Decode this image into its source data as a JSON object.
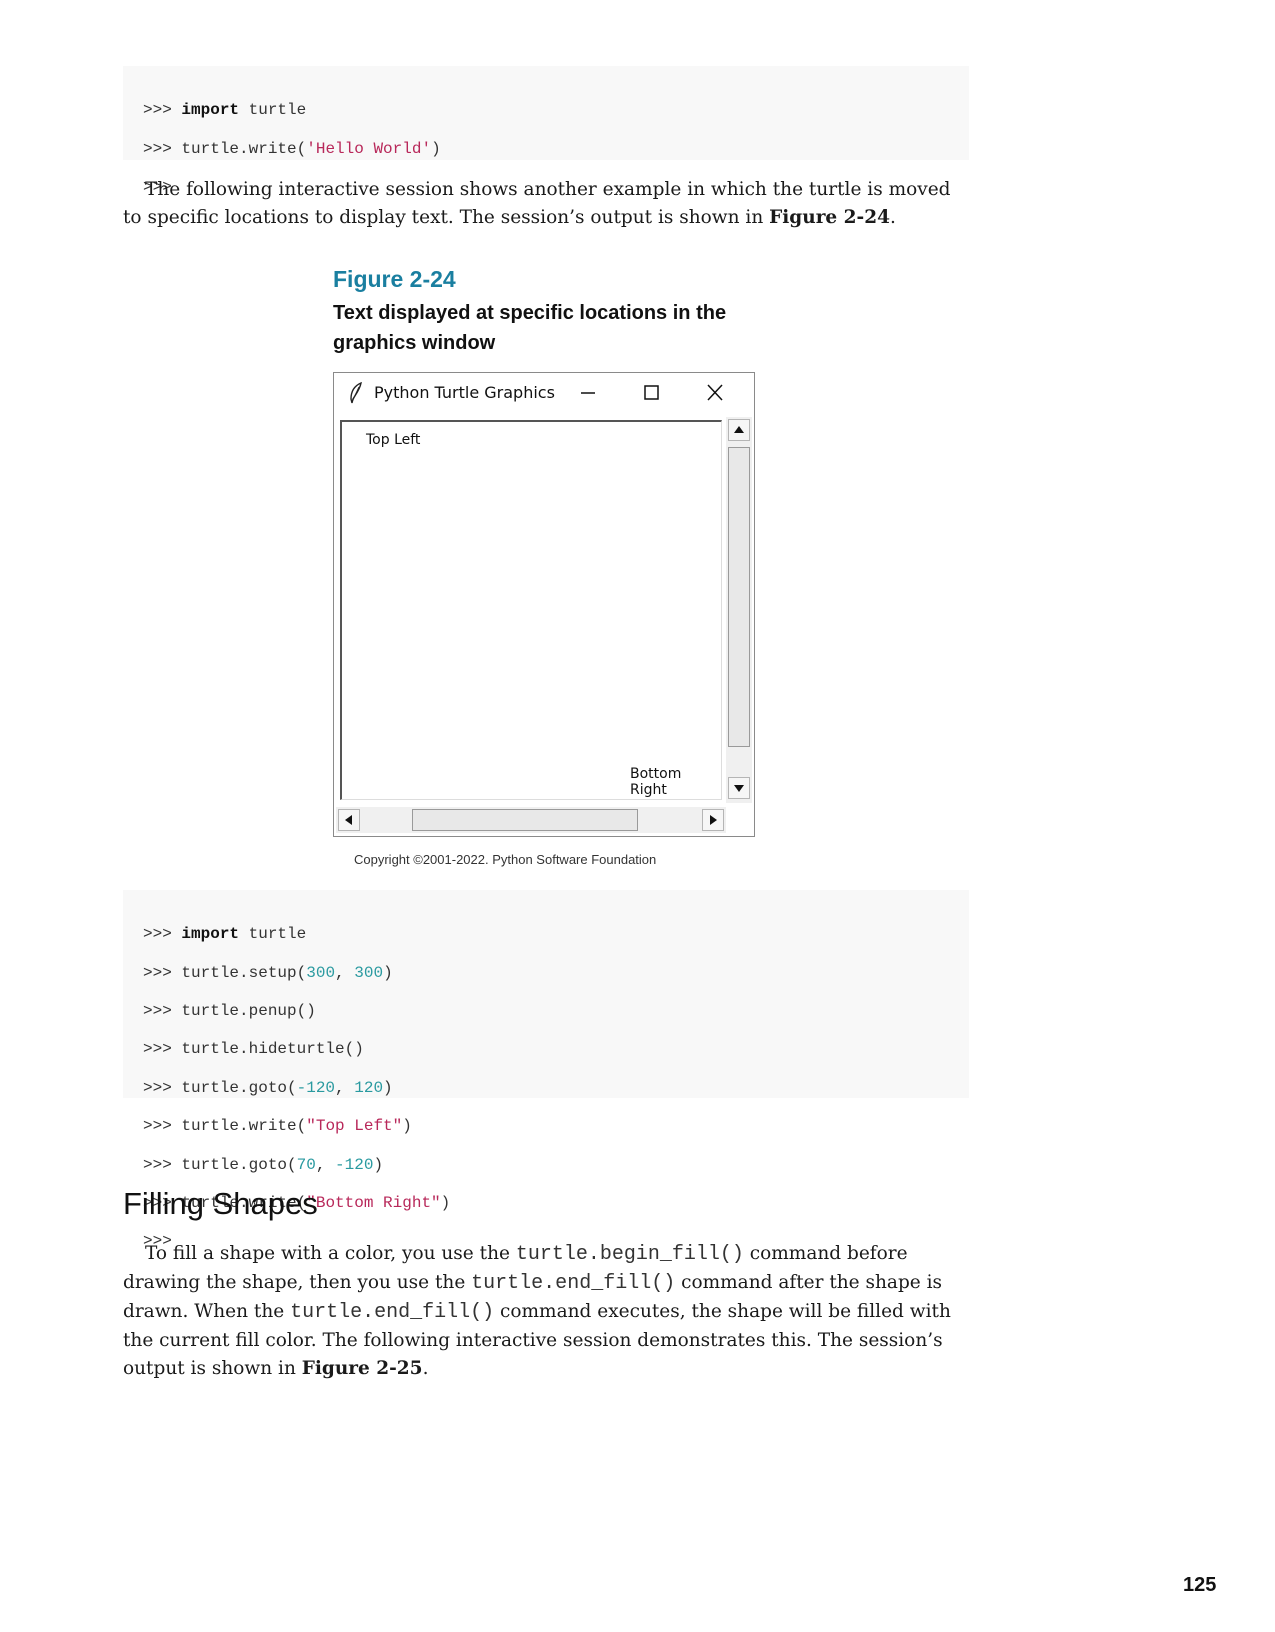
{
  "code1": {
    "lines": [
      {
        "prompt": ">>> ",
        "kw": "import",
        "rest": " turtle"
      },
      {
        "prompt": ">>> ",
        "pre": "turtle.write(",
        "str": "'Hello World'",
        "post": ")"
      },
      {
        "prompt": ">>>"
      }
    ]
  },
  "para1": {
    "text": "The following interactive session shows another example in which the turtle is moved to specific locations to display text. The session’s output is shown in ",
    "ref": "Figure 2-24",
    "end": "."
  },
  "figure": {
    "label": "Figure 2-24",
    "caption": "Text displayed at specific locations in the graphics window",
    "window_title": "Python Turtle Graphics",
    "canvas_text_top_left": "Top Left",
    "canvas_text_bottom_right": "Bottom Right",
    "copyright": "Copyright ©2001-2022. Python Software Foundation",
    "icons": [
      "feather-icon",
      "minimize-icon",
      "maximize-icon",
      "close-icon",
      "scroll-up-arrow-icon",
      "scroll-down-arrow-icon",
      "scroll-left-arrow-icon",
      "scroll-right-arrow-icon"
    ]
  },
  "code2": {
    "l1": {
      "prompt": ">>> ",
      "kw": "import",
      "rest": " turtle"
    },
    "l2": {
      "prompt": ">>> ",
      "pre": "turtle.setup(",
      "n1": "300",
      "sep": ", ",
      "n2": "300",
      "post": ")"
    },
    "l3": {
      "prompt": ">>> ",
      "text": "turtle.penup()"
    },
    "l4": {
      "prompt": ">>> ",
      "text": "turtle.hideturtle()"
    },
    "l5": {
      "prompt": ">>> ",
      "pre": "turtle.goto(",
      "n1": "-120",
      "sep": ", ",
      "n2": "120",
      "post": ")"
    },
    "l6": {
      "prompt": ">>> ",
      "pre": "turtle.write(",
      "str": "\"Top Left\"",
      "post": ")"
    },
    "l7": {
      "prompt": ">>> ",
      "pre": "turtle.goto(",
      "n1": "70",
      "sep": ", ",
      "n2": "-120",
      "post": ")"
    },
    "l8": {
      "prompt": ">>> ",
      "pre": "turtle.write(",
      "str": "\"Bottom Right\"",
      "post": ")"
    },
    "l9": {
      "prompt": ">>>"
    }
  },
  "section": {
    "heading": "Filling Shapes"
  },
  "para2": {
    "t1": "To fill a shape with a color, you use the ",
    "c1": "turtle.begin_fill()",
    "t2": " command before drawing the shape, then you use the ",
    "c2": "turtle.end_fill()",
    "t3": " command after the shape is drawn. When the ",
    "c3": "turtle.end_fill()",
    "t4": " command executes, the shape will be filled with the current fill color. The following interactive session demonstrates this. The session’s output is shown in ",
    "ref": "Figure 2-25",
    "end": "."
  },
  "page_number": "125",
  "colors": {
    "figure_label": "#1a7fa0",
    "code_string": "#b8285a",
    "code_number": "#2a9aa0",
    "code_background": "#f8f8f8"
  }
}
